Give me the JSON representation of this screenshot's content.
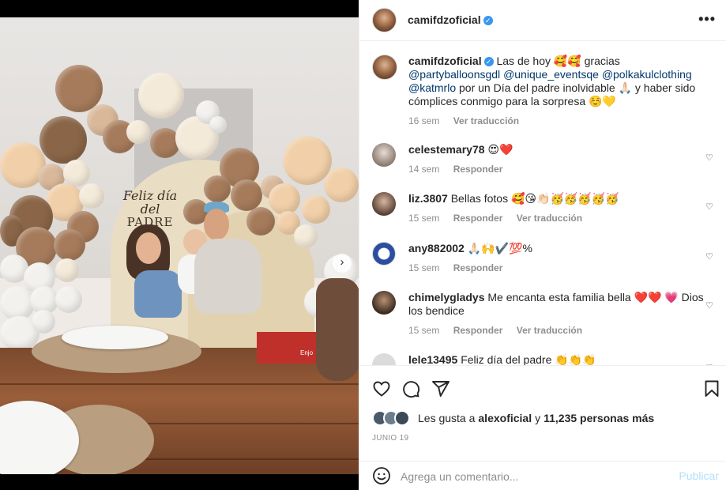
{
  "post": {
    "username": "camifdzoficial",
    "verified": true,
    "more_icon": "more-horizontal-icon"
  },
  "caption": {
    "username": "camifdzoficial",
    "text_1": "Las de hoy 🥰🥰 gracias ",
    "m1": "@partyballoonsgdl",
    "m2": "@unique_eventsqe",
    "m3": "@polkakulclothing",
    "m4": "@katmrlo",
    "text_2": " por un Día del padre inolvidable 🙏🏻 y haber sido cómplices conmigo para la sorpresa ☺️💛",
    "time": "16 sem",
    "translate": "Ver traducción"
  },
  "comments": [
    {
      "username": "celestemary78",
      "text": "😍❤️",
      "time": "14 sem",
      "reply": "Responder",
      "translate": ""
    },
    {
      "username": "liz.3807",
      "text": "Bellas fotos 🥰😘👏🏻🥳🥳🥳🥳🥳",
      "time": "15 sem",
      "reply": "Responder",
      "translate": "Ver traducción"
    },
    {
      "username": "any882002",
      "text": "🙏🏻🙌✔️💯%",
      "time": "15 sem",
      "reply": "Responder",
      "translate": ""
    },
    {
      "username": "chimelygladys",
      "text": "Me encanta esta familia bella ❤️❤️ 💗 Dios los bendice",
      "time": "15 sem",
      "reply": "Responder",
      "translate": "Ver traducción"
    },
    {
      "username": "lele13495",
      "text": "Feliz día del padre 👏👏👏",
      "time": "",
      "reply": "",
      "translate": ""
    }
  ],
  "photo": {
    "sign": {
      "line1": "Feliz día",
      "line2": "del",
      "line3": "PADRE"
    },
    "box_label": "Enjo"
  },
  "likes": {
    "prefix": "Les gusta a ",
    "user": "alexoficial",
    "mid": " y ",
    "count": "11,235 personas más"
  },
  "date": "JUNIO 19",
  "add_comment": {
    "placeholder": "Agrega un comentario...",
    "publish": "Publicar"
  },
  "colors": {
    "mention": "#00376b",
    "verified": "#3897f0",
    "publish_disabled": "#b2dffc",
    "meta": "#8e8e8e"
  }
}
